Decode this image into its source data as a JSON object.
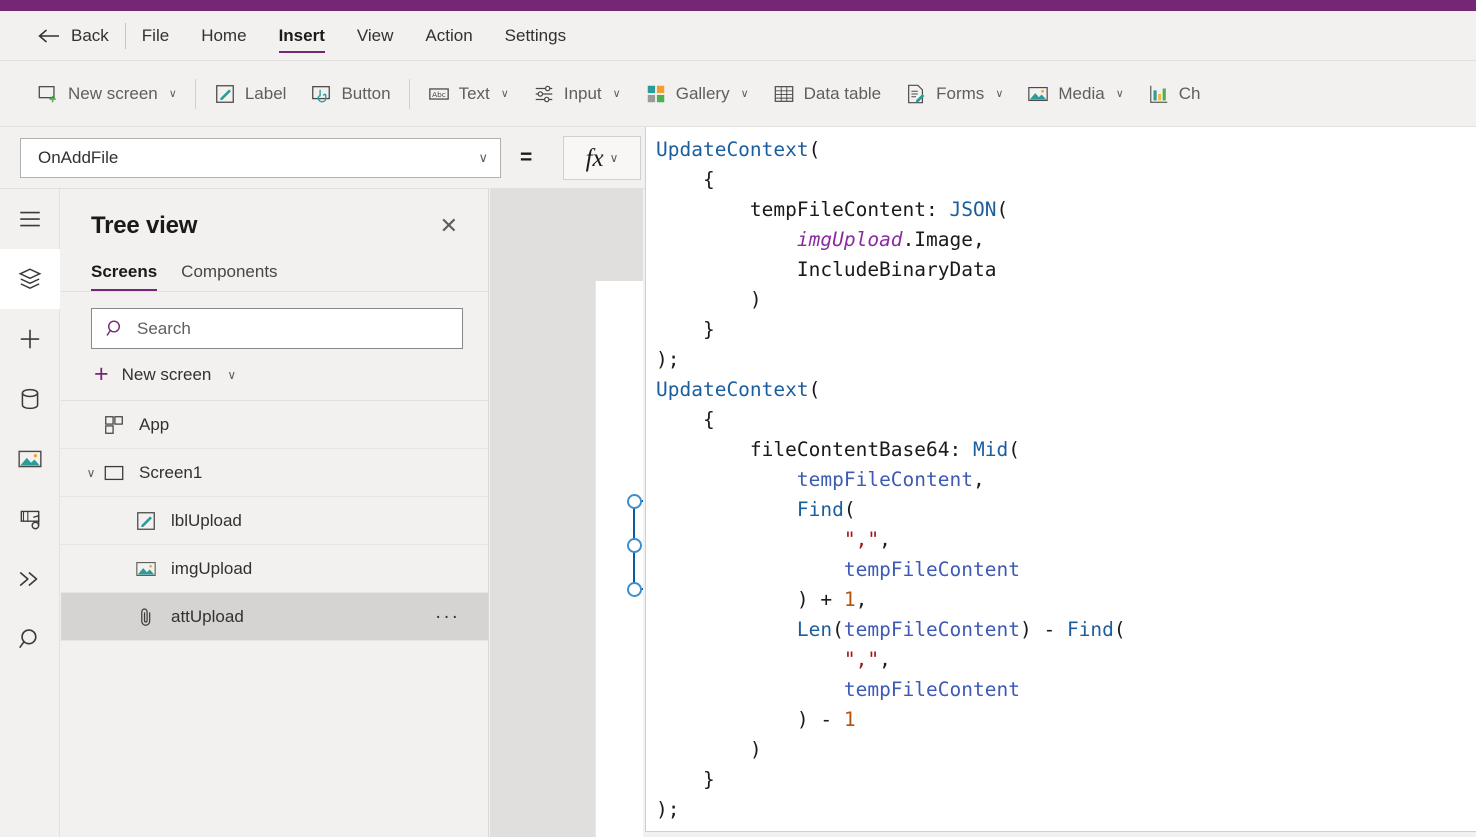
{
  "theme": {
    "brand_purple": "#742774",
    "ribbon_bg": "#f2f1f0",
    "selection_blue": "#3b8fd4",
    "accent_teal": "#2a9d9a"
  },
  "menubar": {
    "back_label": "Back",
    "items": [
      {
        "label": "File",
        "active": false
      },
      {
        "label": "Home",
        "active": false
      },
      {
        "label": "Insert",
        "active": true
      },
      {
        "label": "View",
        "active": false
      },
      {
        "label": "Action",
        "active": false
      },
      {
        "label": "Settings",
        "active": false
      }
    ]
  },
  "ribbon": {
    "items": [
      {
        "label": "New screen",
        "icon": "new-screen-icon",
        "caret": "∨"
      },
      {
        "label": "Label",
        "icon": "label-icon",
        "caret": ""
      },
      {
        "label": "Button",
        "icon": "button-icon",
        "caret": ""
      },
      {
        "label": "Text",
        "icon": "text-icon",
        "caret": "∨"
      },
      {
        "label": "Input",
        "icon": "input-icon",
        "caret": "∨"
      },
      {
        "label": "Gallery",
        "icon": "gallery-icon",
        "caret": "∨"
      },
      {
        "label": "Data table",
        "icon": "data-table-icon",
        "caret": ""
      },
      {
        "label": "Forms",
        "icon": "forms-icon",
        "caret": "∨"
      },
      {
        "label": "Media",
        "icon": "media-icon",
        "caret": "∨"
      },
      {
        "label": "Ch",
        "icon": "charts-icon",
        "caret": ""
      }
    ]
  },
  "formula_bar": {
    "property": "OnAddFile",
    "property_caret": "∨",
    "equals": "=",
    "fx_label": "fx",
    "fx_caret": "∨"
  },
  "left_rail": {
    "items": [
      {
        "name": "menu-icon",
        "active": false
      },
      {
        "name": "tree-view-icon",
        "active": true
      },
      {
        "name": "insert-icon",
        "active": false
      },
      {
        "name": "data-icon",
        "active": false
      },
      {
        "name": "media-icon",
        "active": false
      },
      {
        "name": "power-automate-icon",
        "active": false
      },
      {
        "name": "variables-icon",
        "active": false
      },
      {
        "name": "search-icon",
        "active": false
      }
    ]
  },
  "tree_view": {
    "title": "Tree view",
    "close_label": "✕",
    "tabs": [
      {
        "label": "Screens",
        "active": true
      },
      {
        "label": "Components",
        "active": false
      }
    ],
    "search_placeholder": "Search",
    "new_screen_label": "New screen",
    "new_screen_plus": "+",
    "new_screen_caret": "∨",
    "rows": [
      {
        "label": "App",
        "icon": "app-icon",
        "indent": 0,
        "chevron": "",
        "selected": false,
        "overflow": ""
      },
      {
        "label": "Screen1",
        "icon": "screen-icon",
        "indent": 0,
        "chevron": "∨",
        "selected": false,
        "overflow": ""
      },
      {
        "label": "lblUpload",
        "icon": "label-icon",
        "indent": 1,
        "chevron": "",
        "selected": false,
        "overflow": ""
      },
      {
        "label": "imgUpload",
        "icon": "image-icon",
        "indent": 1,
        "chevron": "",
        "selected": false,
        "overflow": ""
      },
      {
        "label": "attUpload",
        "icon": "attachment-icon",
        "indent": 1,
        "chevron": "",
        "selected": true,
        "overflow": "···"
      }
    ]
  },
  "formula_editor": {
    "lines": [
      [
        {
          "t": "UpdateContext",
          "c": "c-fn"
        },
        {
          "t": "(",
          "c": "c-txt"
        }
      ],
      [
        {
          "t": "    {",
          "c": "c-txt"
        }
      ],
      [
        {
          "t": "        tempFileContent: ",
          "c": "c-txt"
        },
        {
          "t": "JSON",
          "c": "c-fn"
        },
        {
          "t": "(",
          "c": "c-txt"
        }
      ],
      [
        {
          "t": "            ",
          "c": "c-txt"
        },
        {
          "t": "imgUpload",
          "c": "c-ctx"
        },
        {
          "t": ".Image,",
          "c": "c-txt"
        }
      ],
      [
        {
          "t": "            IncludeBinaryData",
          "c": "c-txt"
        }
      ],
      [
        {
          "t": "        )",
          "c": "c-txt"
        }
      ],
      [
        {
          "t": "    }",
          "c": "c-txt"
        }
      ],
      [
        {
          "t": ");",
          "c": "c-txt"
        }
      ],
      [
        {
          "t": "UpdateContext",
          "c": "c-fn"
        },
        {
          "t": "(",
          "c": "c-txt"
        }
      ],
      [
        {
          "t": "    {",
          "c": "c-txt"
        }
      ],
      [
        {
          "t": "        fileContentBase64: ",
          "c": "c-txt"
        },
        {
          "t": "Mid",
          "c": "c-fn"
        },
        {
          "t": "(",
          "c": "c-txt"
        }
      ],
      [
        {
          "t": "            ",
          "c": "c-txt"
        },
        {
          "t": "tempFileContent",
          "c": "c-var"
        },
        {
          "t": ",",
          "c": "c-txt"
        }
      ],
      [
        {
          "t": "            ",
          "c": "c-txt"
        },
        {
          "t": "Find",
          "c": "c-fn"
        },
        {
          "t": "(",
          "c": "c-txt"
        }
      ],
      [
        {
          "t": "                ",
          "c": "c-txt"
        },
        {
          "t": "\",\"",
          "c": "c-str"
        },
        {
          "t": ",",
          "c": "c-txt"
        }
      ],
      [
        {
          "t": "                ",
          "c": "c-txt"
        },
        {
          "t": "tempFileContent",
          "c": "c-var"
        }
      ],
      [
        {
          "t": "            ) + ",
          "c": "c-txt"
        },
        {
          "t": "1",
          "c": "c-num"
        },
        {
          "t": ",",
          "c": "c-txt"
        }
      ],
      [
        {
          "t": "            ",
          "c": "c-txt"
        },
        {
          "t": "Len",
          "c": "c-fn"
        },
        {
          "t": "(",
          "c": "c-txt"
        },
        {
          "t": "tempFileContent",
          "c": "c-var"
        },
        {
          "t": ") - ",
          "c": "c-txt"
        },
        {
          "t": "Find",
          "c": "c-fn"
        },
        {
          "t": "(",
          "c": "c-txt"
        }
      ],
      [
        {
          "t": "                ",
          "c": "c-txt"
        },
        {
          "t": "\",\"",
          "c": "c-str"
        },
        {
          "t": ",",
          "c": "c-txt"
        }
      ],
      [
        {
          "t": "                ",
          "c": "c-txt"
        },
        {
          "t": "tempFileContent",
          "c": "c-var"
        }
      ],
      [
        {
          "t": "            ) - ",
          "c": "c-txt"
        },
        {
          "t": "1",
          "c": "c-num"
        }
      ],
      [
        {
          "t": "        )",
          "c": "c-txt"
        }
      ],
      [
        {
          "t": "    }",
          "c": "c-txt"
        }
      ],
      [
        {
          "t": ");",
          "c": "c-txt"
        }
      ]
    ]
  }
}
